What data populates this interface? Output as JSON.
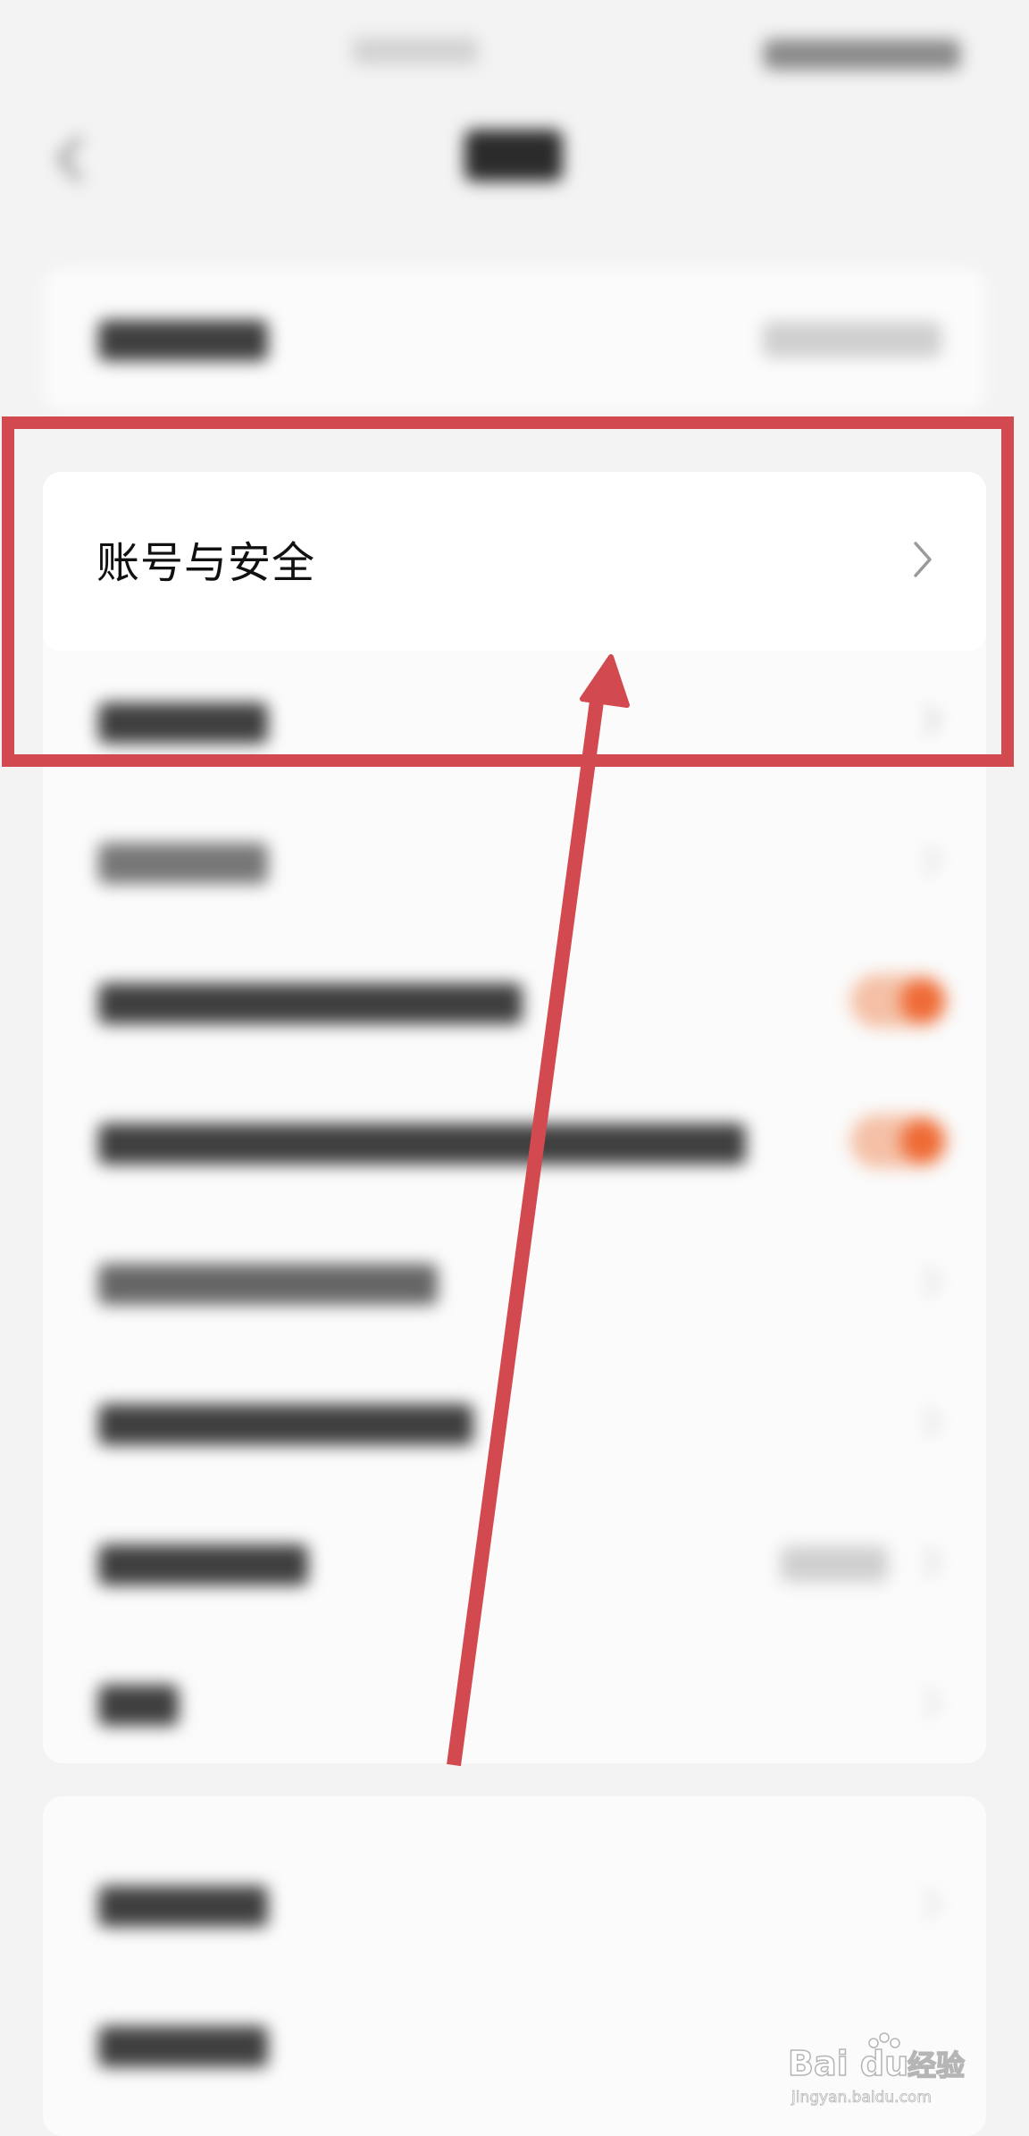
{
  "highlighted_item": {
    "label": "账号与安全"
  },
  "colors": {
    "annotation_red": "#d24a4f",
    "toggle_orange": "#ef6a35",
    "background": "#f3f3f3",
    "card": "#fbfbfb"
  },
  "icons": {
    "back": "chevron-left-icon",
    "row_arrow": "chevron-right-icon"
  },
  "watermark": {
    "brand": "Bai du",
    "suffix": "经验",
    "url": "jingyan.baidu.com"
  }
}
